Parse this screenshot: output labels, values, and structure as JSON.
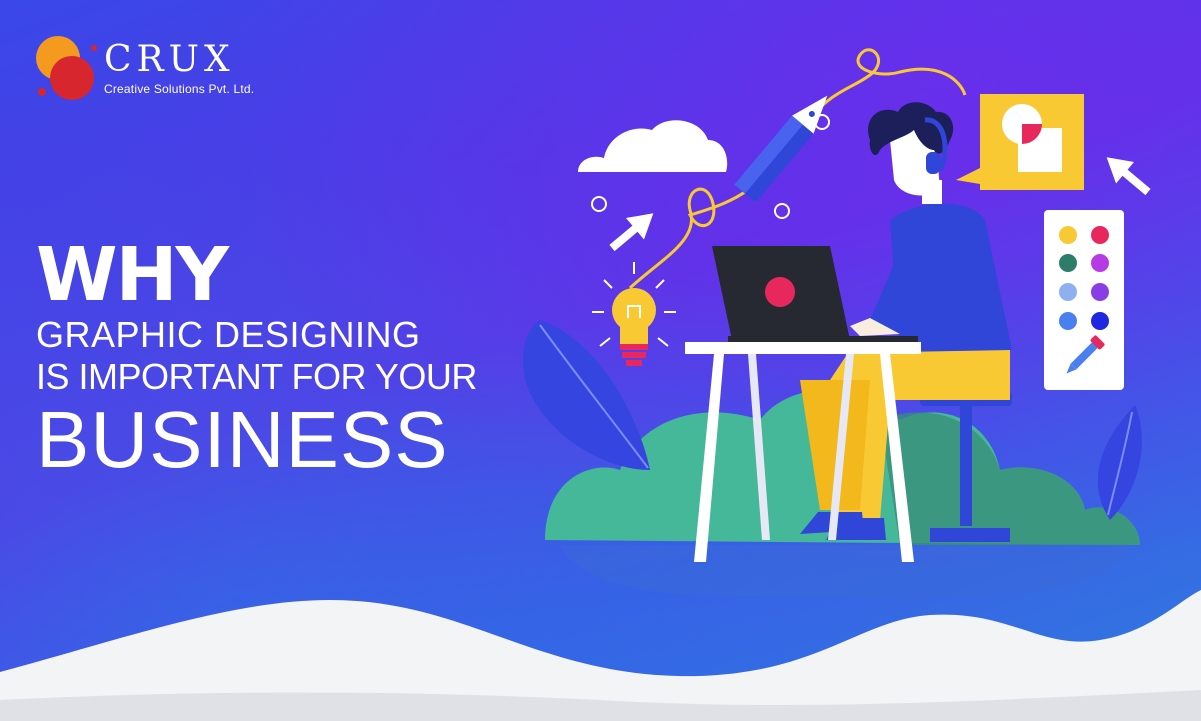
{
  "brand": {
    "name": "CRUX",
    "tagline": "Creative Solutions Pvt. Ltd."
  },
  "headline": {
    "line1": "WHY",
    "line2": "GRAPHIC DESIGNING",
    "line3": "IS IMPORTANT FOR YOUR",
    "line4": "BUSINESS"
  },
  "colors": {
    "background_top": "#5a34e6",
    "background_bottom": "#2f7de0",
    "logo_orange": "#f39a1f",
    "logo_red": "#d8262f",
    "accent_yellow": "#f9c934",
    "accent_pink": "#e8285c",
    "shirt_blue": "#2f46d8",
    "laptop_dark": "#262832",
    "plant_green": "#4cbf9a",
    "wave_white": "#f3f4f6"
  },
  "illustration": {
    "icons": [
      "cloud-icon",
      "pen-nib-icon",
      "lightbulb-icon",
      "arrow-cursor-icon",
      "color-palette-icon",
      "eyedropper-icon",
      "laptop-icon",
      "headset-icon",
      "leaf-icon"
    ],
    "palette_swatches": [
      "#f9c934",
      "#e8285c",
      "#2e7d6a",
      "#b63be6",
      "#8fb0f0",
      "#8a3de6",
      "#4a7ff0",
      "#1f28e0"
    ]
  }
}
